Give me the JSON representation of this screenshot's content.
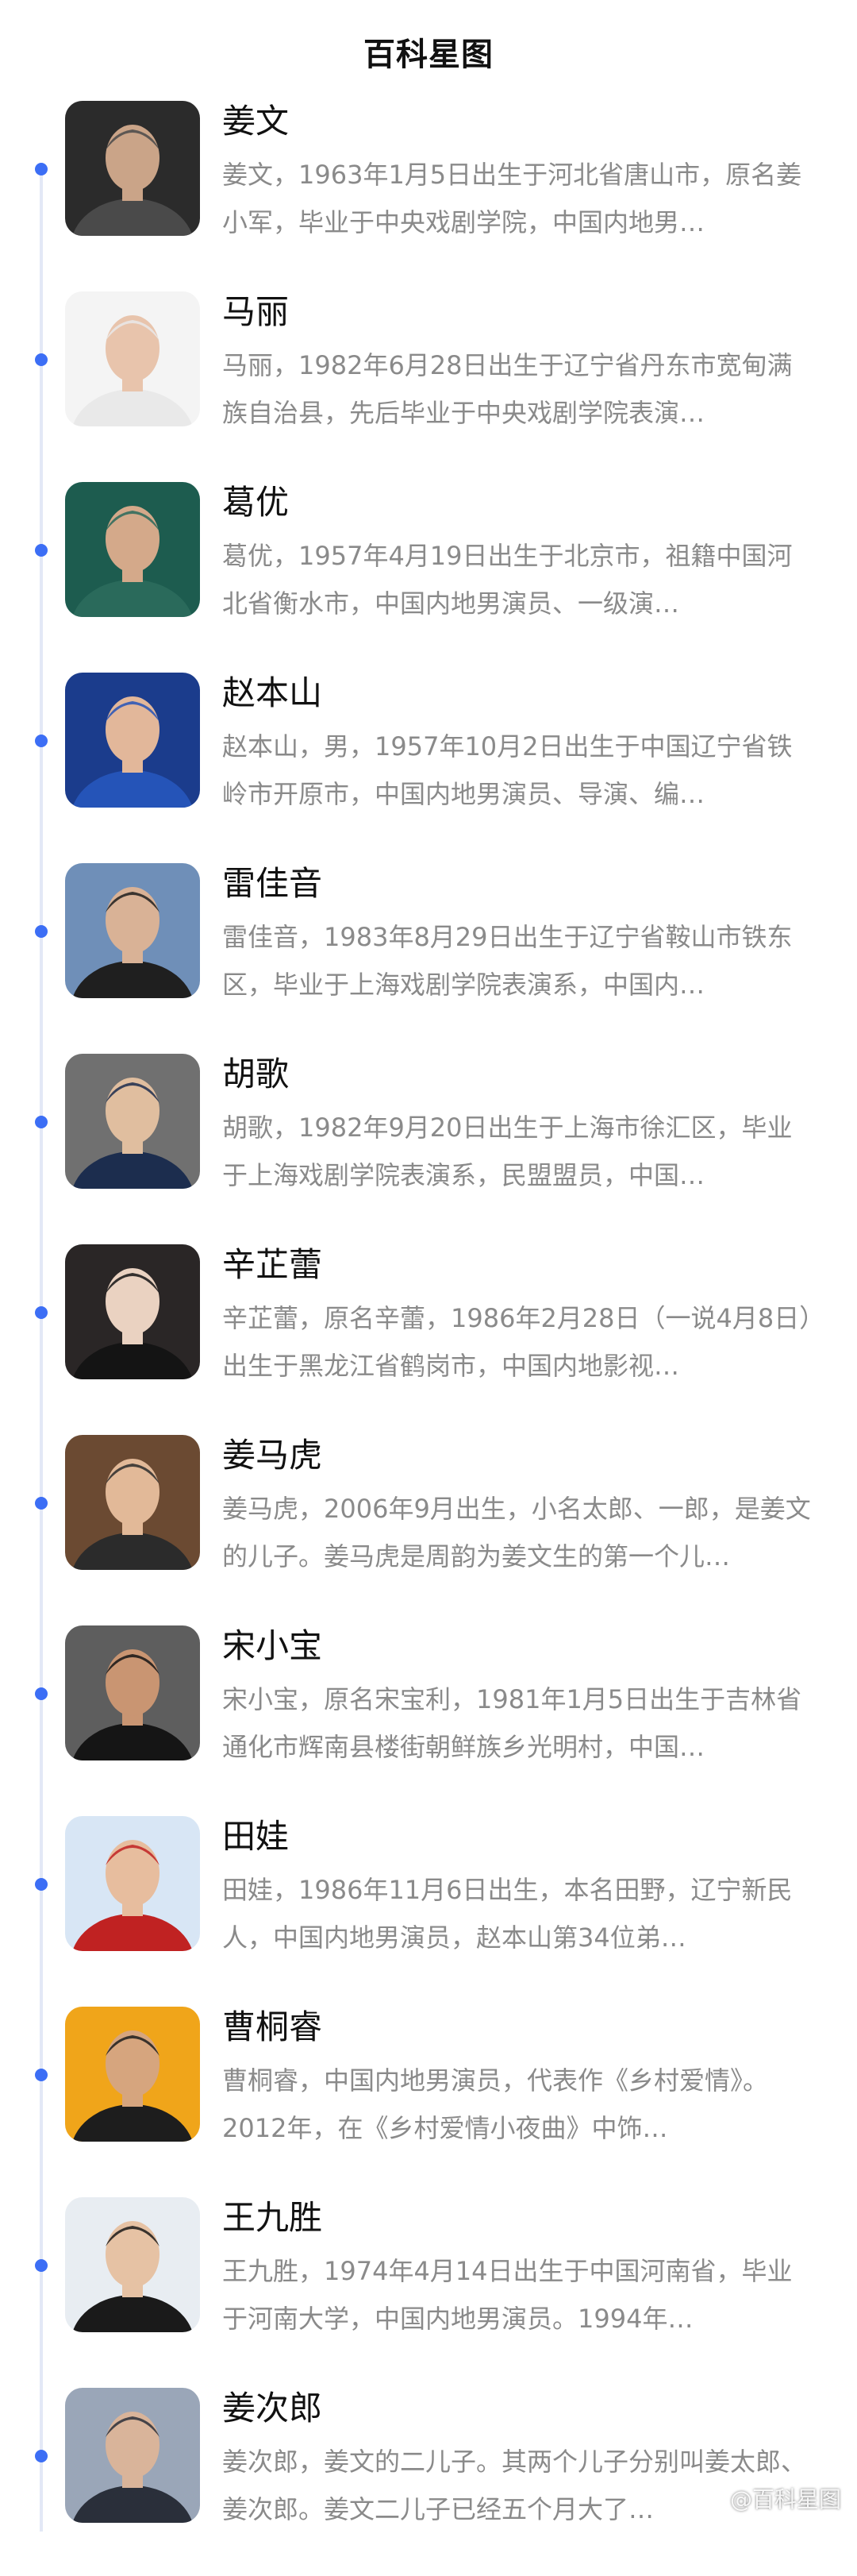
{
  "header": {
    "title": "百科星图"
  },
  "people": [
    {
      "name": "姜文",
      "desc": "姜文，1963年1月5日出生于河北省唐山市，原名姜小军，毕业于中央戏剧学院，中国内地男…",
      "avatar_colors": [
        "#2b2b2b",
        "#4a4a4a",
        "#caa488"
      ]
    },
    {
      "name": "马丽",
      "desc": "马丽，1982年6月28日出生于辽宁省丹东市宽甸满族自治县，先后毕业于中央戏剧学院表演…",
      "avatar_colors": [
        "#f4f4f4",
        "#e9e9e9",
        "#e8c4ac"
      ]
    },
    {
      "name": "葛优",
      "desc": "葛优，1957年4月19日出生于北京市，祖籍中国河北省衡水市，中国内地男演员、一级演…",
      "avatar_colors": [
        "#1d5c4f",
        "#2a6a5b",
        "#d4a98a"
      ]
    },
    {
      "name": "赵本山",
      "desc": "赵本山，男，1957年10月2日出生于中国辽宁省铁岭市开原市，中国内地男演员、导演、编…",
      "avatar_colors": [
        "#1b3c8c",
        "#2554b8",
        "#e2b79a"
      ]
    },
    {
      "name": "雷佳音",
      "desc": "雷佳音，1983年8月29日出生于辽宁省鞍山市铁东区，毕业于上海戏剧学院表演系，中国内…",
      "avatar_colors": [
        "#6f8fb8",
        "#1f1f1f",
        "#d9b296"
      ]
    },
    {
      "name": "胡歌",
      "desc": "胡歌，1982年9月20日出生于上海市徐汇区，毕业于上海戏剧学院表演系，民盟盟员，中国…",
      "avatar_colors": [
        "#707070",
        "#1c2d4e",
        "#e0be9f"
      ]
    },
    {
      "name": "辛芷蕾",
      "desc": "辛芷蕾，原名辛蕾，1986年2月28日（一说4月8日）出生于黑龙江省鹤岗市，中国内地影视…",
      "avatar_colors": [
        "#2a2626",
        "#141414",
        "#ead2c1"
      ]
    },
    {
      "name": "姜马虎",
      "desc": "姜马虎，2006年9月出生，小名太郎、一郎，是姜文的儿子。姜马虎是周韵为姜文生的第一个儿…",
      "avatar_colors": [
        "#6b4a32",
        "#2b2b2b",
        "#e2b998"
      ]
    },
    {
      "name": "宋小宝",
      "desc": "宋小宝，原名宋宝利，1981年1月5日出生于吉林省通化市辉南县楼街朝鲜族乡光明村，中国…",
      "avatar_colors": [
        "#5e5e5e",
        "#151515",
        "#c99572"
      ]
    },
    {
      "name": "田娃",
      "desc": "田娃，1986年11月6日出生，本名田野，辽宁新民人，中国内地男演员，赵本山第34位弟…",
      "avatar_colors": [
        "#d8e6f5",
        "#c02222",
        "#e7bd9e"
      ]
    },
    {
      "name": "曹桐睿",
      "desc": "曹桐睿，中国内地男演员，代表作《乡村爱情》。2012年，在《乡村爱情小夜曲》中饰…",
      "avatar_colors": [
        "#f0a51a",
        "#1d1d1d",
        "#d6a57e"
      ]
    },
    {
      "name": "王九胜",
      "desc": "王九胜，1974年4月14日出生于中国河南省，毕业于河南大学，中国内地男演员。1994年…",
      "avatar_colors": [
        "#e8edf2",
        "#1a1a1a",
        "#e6c2a4"
      ]
    },
    {
      "name": "姜次郎",
      "desc": "姜次郎，姜文的二儿子。其两个儿子分别叫姜太郎、姜次郎。姜文二儿子已经五个月大了…",
      "avatar_colors": [
        "#9aa6b8",
        "#2a2f3a",
        "#d9b49a"
      ]
    }
  ],
  "watermark": "@百科星图"
}
